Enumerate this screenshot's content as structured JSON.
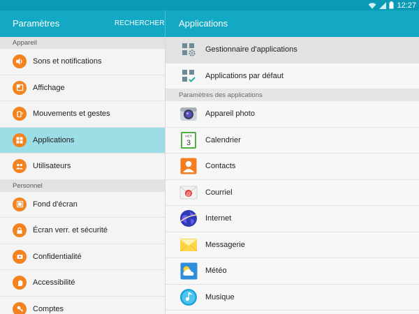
{
  "status_bar": {
    "time": "12:27"
  },
  "header": {
    "left_title": "Paramètres",
    "search_label": "RECHERCHER",
    "right_title": "Applications"
  },
  "sidebar": {
    "sections": [
      {
        "title": "Appareil",
        "items": [
          {
            "label": "Sons et notifications",
            "icon": "volume-icon",
            "active": false
          },
          {
            "label": "Affichage",
            "icon": "display-icon",
            "active": false
          },
          {
            "label": "Mouvements et gestes",
            "icon": "gesture-icon",
            "active": false
          },
          {
            "label": "Applications",
            "icon": "apps-grid-icon",
            "active": true
          },
          {
            "label": "Utilisateurs",
            "icon": "users-icon",
            "active": false
          }
        ]
      },
      {
        "title": "Personnel",
        "items": [
          {
            "label": "Fond d'écran",
            "icon": "wallpaper-icon",
            "active": false
          },
          {
            "label": "Écran verr. et sécurité",
            "icon": "lock-icon",
            "active": false
          },
          {
            "label": "Confidentialité",
            "icon": "privacy-icon",
            "active": false
          },
          {
            "label": "Accessibilité",
            "icon": "hand-icon",
            "active": false
          },
          {
            "label": "Comptes",
            "icon": "key-icon",
            "active": false
          }
        ]
      }
    ],
    "accent_color": "#f2831f",
    "active_color": "#9cdde6"
  },
  "main": {
    "top_items": [
      {
        "label": "Gestionnaire d'applications",
        "icon": "app-manager-icon",
        "selected": true
      },
      {
        "label": "Applications par défaut",
        "icon": "default-apps-icon",
        "selected": false
      }
    ],
    "section_title": "Paramètres des applications",
    "apps": [
      {
        "label": "Appareil photo",
        "icon": "camera-icon"
      },
      {
        "label": "Calendrier",
        "icon": "calendar-icon",
        "calendar_month": "MER",
        "calendar_day": "3"
      },
      {
        "label": "Contacts",
        "icon": "contacts-icon"
      },
      {
        "label": "Courriel",
        "icon": "email-icon"
      },
      {
        "label": "Internet",
        "icon": "internet-globe-icon"
      },
      {
        "label": "Messagerie",
        "icon": "messaging-icon"
      },
      {
        "label": "Météo",
        "icon": "weather-icon"
      },
      {
        "label": "Musique",
        "icon": "music-icon"
      }
    ]
  },
  "colors": {
    "status_bar": "#0a9ab5",
    "app_bar": "#13a8c4"
  }
}
